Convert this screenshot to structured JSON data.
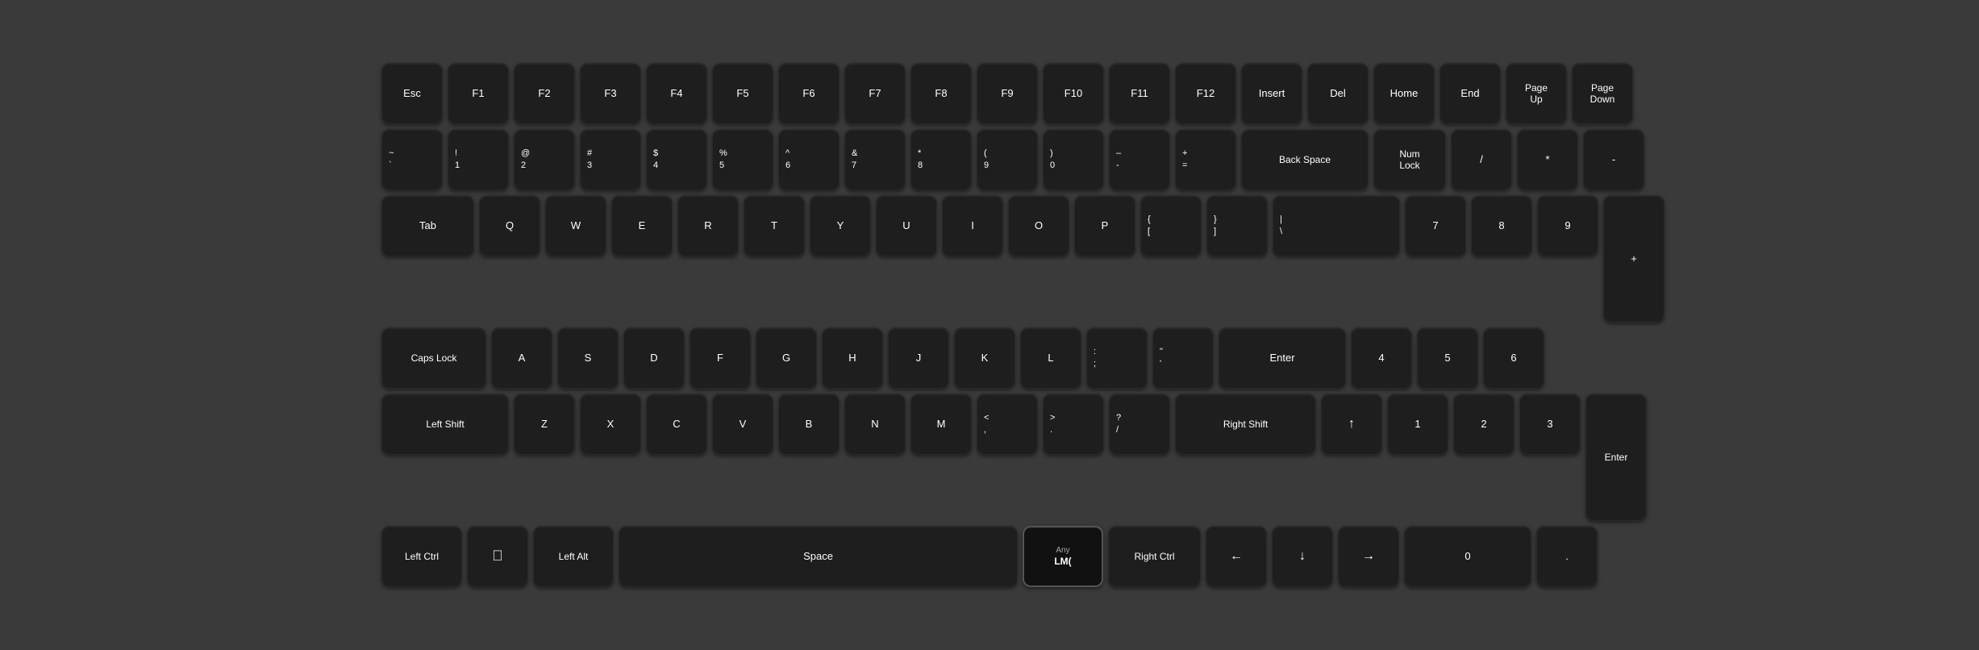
{
  "keyboard": {
    "rows": {
      "function_row": [
        "Esc",
        "F1",
        "F2",
        "F3",
        "F4",
        "F5",
        "F6",
        "F7",
        "F8",
        "F9",
        "F10",
        "F11",
        "F12",
        "Insert",
        "Del",
        "Home",
        "End",
        "Page Up",
        "Page Down"
      ],
      "number_row": [
        "~\n`",
        "!\n1",
        "@\n2",
        "#\n3",
        "$\n4",
        "%\n5",
        "^\n6",
        "&\n7",
        "*\n8",
        "(\n9",
        ")\n0",
        "-\n-",
        "+\n=",
        "Back Space",
        "Num Lock",
        "/",
        "*",
        "-"
      ],
      "qwerty_row": [
        "Tab",
        "Q",
        "W",
        "E",
        "R",
        "T",
        "Y",
        "U",
        "I",
        "O",
        "P",
        "{\n[",
        "}\n]",
        "\\\n|",
        "7",
        "8",
        "9"
      ],
      "home_row": [
        "Caps Lock",
        "A",
        "S",
        "D",
        "F",
        "G",
        "H",
        "J",
        "K",
        "L",
        ":\n;",
        "\"\n'",
        "Enter",
        "4",
        "5",
        "6"
      ],
      "shift_row": [
        "Left Shift",
        "Z",
        "X",
        "C",
        "V",
        "B",
        "N",
        "M",
        "<\n,",
        ">\n.",
        "?\n/",
        "Right Shift",
        "↑",
        "1",
        "2",
        "3"
      ],
      "bottom_row": [
        "Left Ctrl",
        "⌘",
        "Left Alt",
        "Space",
        "Any\nLM(",
        "Right Ctrl",
        "←",
        "↓",
        "→",
        "0",
        "."
      ]
    }
  }
}
